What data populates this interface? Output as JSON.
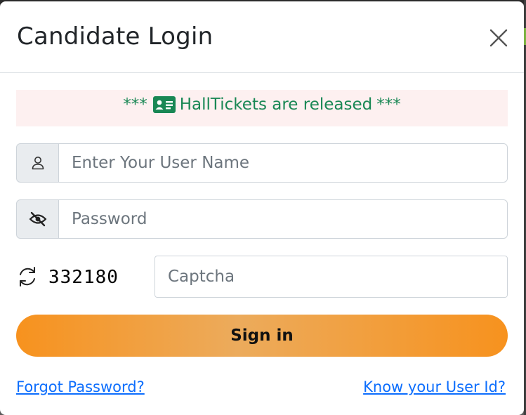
{
  "modal": {
    "title": "Candidate Login"
  },
  "notice": {
    "prefix": "***",
    "text": "HallTickets are released",
    "suffix": "***",
    "color": "#198754",
    "background": "#fdf0f0"
  },
  "form": {
    "username_placeholder": "Enter Your User Name",
    "password_placeholder": "Password",
    "captcha_code": "332180",
    "captcha_placeholder": "Captcha",
    "signin_label": "Sign in"
  },
  "links": {
    "forgot_password": "Forgot Password?",
    "know_user_id": "Know your User Id?"
  },
  "icons": {
    "close": "close-icon",
    "id_card": "id-card-icon",
    "user": "user-icon",
    "eye_slash": "eye-slash-icon",
    "refresh": "refresh-icon"
  },
  "colors": {
    "accent": "#f7921e",
    "link": "#0d6efd"
  }
}
